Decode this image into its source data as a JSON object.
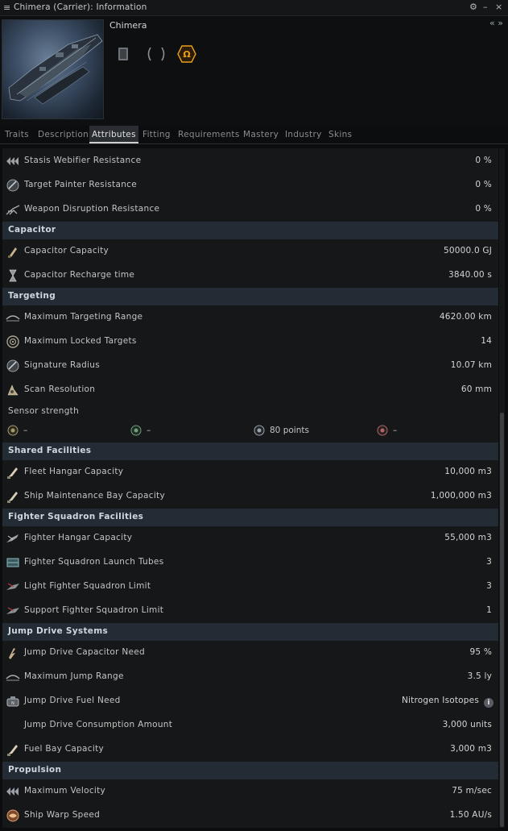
{
  "window": {
    "title": "Chimera (Carrier): Information",
    "controls": [
      "⚙",
      "–",
      "×"
    ]
  },
  "ship": {
    "name": "Chimera",
    "collapse_label": "« »"
  },
  "tabs": [
    {
      "label": "Traits",
      "active": false
    },
    {
      "label": "Description",
      "active": false
    },
    {
      "label": "Attributes",
      "active": true
    },
    {
      "label": "Fitting",
      "active": false
    },
    {
      "label": "Requirements",
      "active": false
    },
    {
      "label": "Mastery",
      "active": false
    },
    {
      "label": "Industry",
      "active": false
    },
    {
      "label": "Skins",
      "active": false
    }
  ],
  "attributes": {
    "stasis_webifier_resistance": {
      "label": "Stasis Webifier Resistance",
      "value": "0 %"
    },
    "target_painter_resistance": {
      "label": "Target Painter Resistance",
      "value": "0 %"
    },
    "weapon_disruption_resistance": {
      "label": "Weapon Disruption Resistance",
      "value": "0 %"
    },
    "capacitor_header": "Capacitor",
    "capacitor_capacity": {
      "label": "Capacitor Capacity",
      "value": "50000.0 GJ"
    },
    "capacitor_recharge_time": {
      "label": "Capacitor Recharge time",
      "value": "3840.00 s"
    },
    "targeting_header": "Targeting",
    "maximum_targeting_range": {
      "label": "Maximum Targeting Range",
      "value": "4620.00 km"
    },
    "maximum_locked_targets": {
      "label": "Maximum Locked Targets",
      "value": "14"
    },
    "signature_radius": {
      "label": "Signature Radius",
      "value": "10.07 km"
    },
    "scan_resolution": {
      "label": "Scan Resolution",
      "value": "60 mm"
    },
    "sensor_strength": {
      "label": "Sensor strength",
      "values": [
        "–",
        "–",
        "80 points",
        "–"
      ]
    },
    "shared_facilities_header": "Shared Facilities",
    "fleet_hangar_capacity": {
      "label": "Fleet Hangar Capacity",
      "value": "10,000 m3"
    },
    "ship_maintenance_bay_capacity": {
      "label": "Ship Maintenance Bay Capacity",
      "value": "1,000,000 m3"
    },
    "fighter_squadron_header": "Fighter Squadron Facilities",
    "fighter_hangar_capacity": {
      "label": "Fighter Hangar Capacity",
      "value": "55,000 m3"
    },
    "fighter_squadron_launch_tubes": {
      "label": "Fighter Squadron Launch Tubes",
      "value": "3"
    },
    "light_fighter_squadron_limit": {
      "label": "Light Fighter Squadron Limit",
      "value": "3"
    },
    "support_fighter_squadron_limit": {
      "label": "Support Fighter Squadron Limit",
      "value": "1"
    },
    "jump_drive_header": "Jump Drive Systems",
    "jump_drive_capacitor_need": {
      "label": "Jump Drive Capacitor Need",
      "value": "95 %"
    },
    "maximum_jump_range": {
      "label": "Maximum Jump Range",
      "value": "3.5 ly"
    },
    "jump_drive_fuel_need": {
      "label": "Jump Drive Fuel Need",
      "value": "Nitrogen Isotopes",
      "info": "i"
    },
    "jump_drive_consumption_amount": {
      "label": "Jump Drive Consumption Amount",
      "value": "3,000 units"
    },
    "fuel_bay_capacity": {
      "label": "Fuel Bay Capacity",
      "value": "3,000 m3"
    },
    "propulsion_header": "Propulsion",
    "maximum_velocity": {
      "label": "Maximum Velocity",
      "value": "75 m/sec"
    },
    "ship_warp_speed": {
      "label": "Ship Warp Speed",
      "value": "1.50 AU/s"
    }
  },
  "colors": {
    "accent_omega": "#e8a01a",
    "section_header_bg": "#232b35",
    "panel_bg": "#151719"
  }
}
